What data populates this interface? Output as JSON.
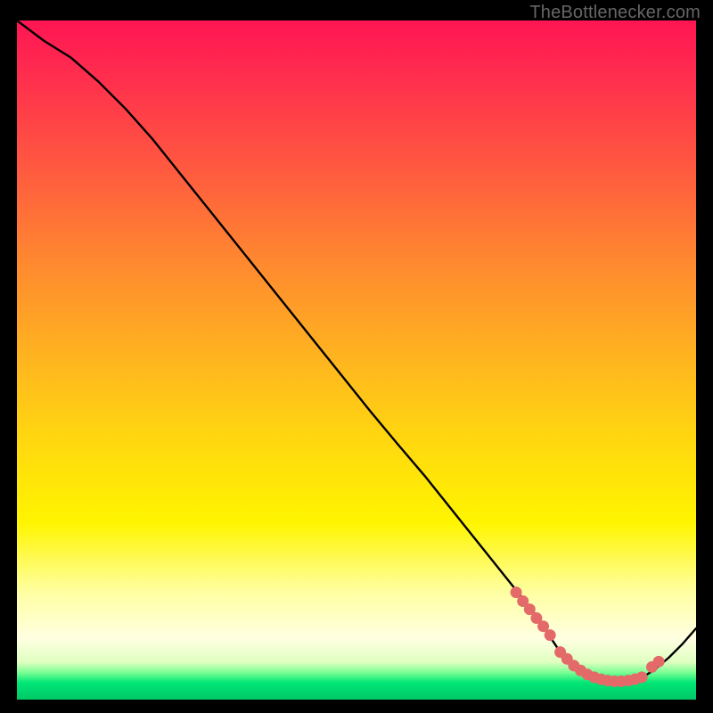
{
  "watermark": "TheBottlenecker.com",
  "chart_data": {
    "type": "line",
    "title": "",
    "xlabel": "",
    "ylabel": "",
    "xlim": [
      0,
      100
    ],
    "ylim": [
      0,
      100
    ],
    "grid": false,
    "curve": {
      "name": "bottleneck-curve",
      "x": [
        0,
        4,
        8,
        12,
        16,
        20,
        24,
        28,
        32,
        36,
        40,
        44,
        48,
        52,
        56,
        60,
        64,
        68,
        72,
        74,
        76,
        78,
        80,
        82,
        84,
        86,
        88,
        90,
        92,
        94,
        96,
        98,
        100
      ],
      "y": [
        100,
        97,
        94.5,
        91,
        87,
        82.5,
        77.5,
        72.5,
        67.5,
        62.5,
        57.5,
        52.5,
        47.5,
        42.5,
        37.7,
        33,
        28,
        23,
        18,
        15.5,
        13,
        10,
        7,
        5,
        3.5,
        2.7,
        2.5,
        2.7,
        3.2,
        4.5,
        6.2,
        8.2,
        10.5
      ]
    },
    "markers": {
      "name": "highlight-points",
      "x": [
        73.5,
        74.5,
        75.5,
        76.5,
        77.5,
        78.5,
        80,
        81,
        82,
        83,
        84,
        85,
        86,
        87,
        88,
        89,
        90,
        91,
        92,
        93.5,
        94.5
      ],
      "y": [
        15.8,
        14.5,
        13.3,
        12.0,
        10.8,
        9.5,
        7.0,
        6.0,
        5.0,
        4.3,
        3.7,
        3.3,
        3.0,
        2.8,
        2.7,
        2.7,
        2.8,
        3.0,
        3.3,
        4.8,
        5.6
      ]
    },
    "gradient_stops": [
      {
        "pct": 0,
        "color": "#ff1553"
      },
      {
        "pct": 50,
        "color": "#ffb51f"
      },
      {
        "pct": 74,
        "color": "#fff500"
      },
      {
        "pct": 91,
        "color": "#ffffe2"
      },
      {
        "pct": 97.5,
        "color": "#00e676"
      },
      {
        "pct": 100,
        "color": "#00c866"
      }
    ]
  },
  "colors": {
    "curve_stroke": "#000000",
    "marker_fill": "#e46a6a",
    "marker_stroke": "#e46a6a"
  }
}
